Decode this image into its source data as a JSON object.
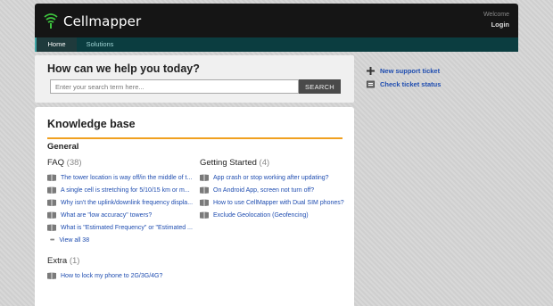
{
  "header": {
    "brand": "Cellmapper",
    "welcome": "Welcome",
    "login": "Login"
  },
  "nav": {
    "tabs": [
      {
        "label": "Home"
      },
      {
        "label": "Solutions"
      }
    ]
  },
  "help": {
    "title": "How can we help you today?",
    "search_placeholder": "Enter your search term here...",
    "search_button": "SEARCH"
  },
  "side_links": [
    {
      "label": "New support ticket",
      "icon": "plus-icon"
    },
    {
      "label": "Check ticket status",
      "icon": "ticket-icon"
    }
  ],
  "kb": {
    "title": "Knowledge base",
    "section": "General",
    "categories": [
      {
        "name": "FAQ",
        "count": "(38)",
        "articles": [
          "The tower location is way off/in the middle of t...",
          "A single cell is stretching for 5/10/15 km or m...",
          "Why isn't the uplink/downlink frequency displa...",
          "What are \"low accuracy\" towers?",
          "What is \"Estimated Frequency\" or \"Estimated ..."
        ],
        "view_all": "View all 38"
      },
      {
        "name": "Getting Started",
        "count": "(4)",
        "articles": [
          "App crash or stop working after updating?",
          "On Android App, screen not turn off?",
          "How to use CellMapper with Dual SIM phones?",
          "Exclude Geolocation (Geofencing)"
        ]
      },
      {
        "name": "Extra",
        "count": "(1)",
        "articles": [
          "How to lock my phone to 2G/3G/4G?"
        ]
      }
    ]
  },
  "colors": {
    "accent_rule": "#f0a020",
    "link": "#1f4db0",
    "nav_bar": "#0b3d40",
    "header_bg": "#151515"
  }
}
